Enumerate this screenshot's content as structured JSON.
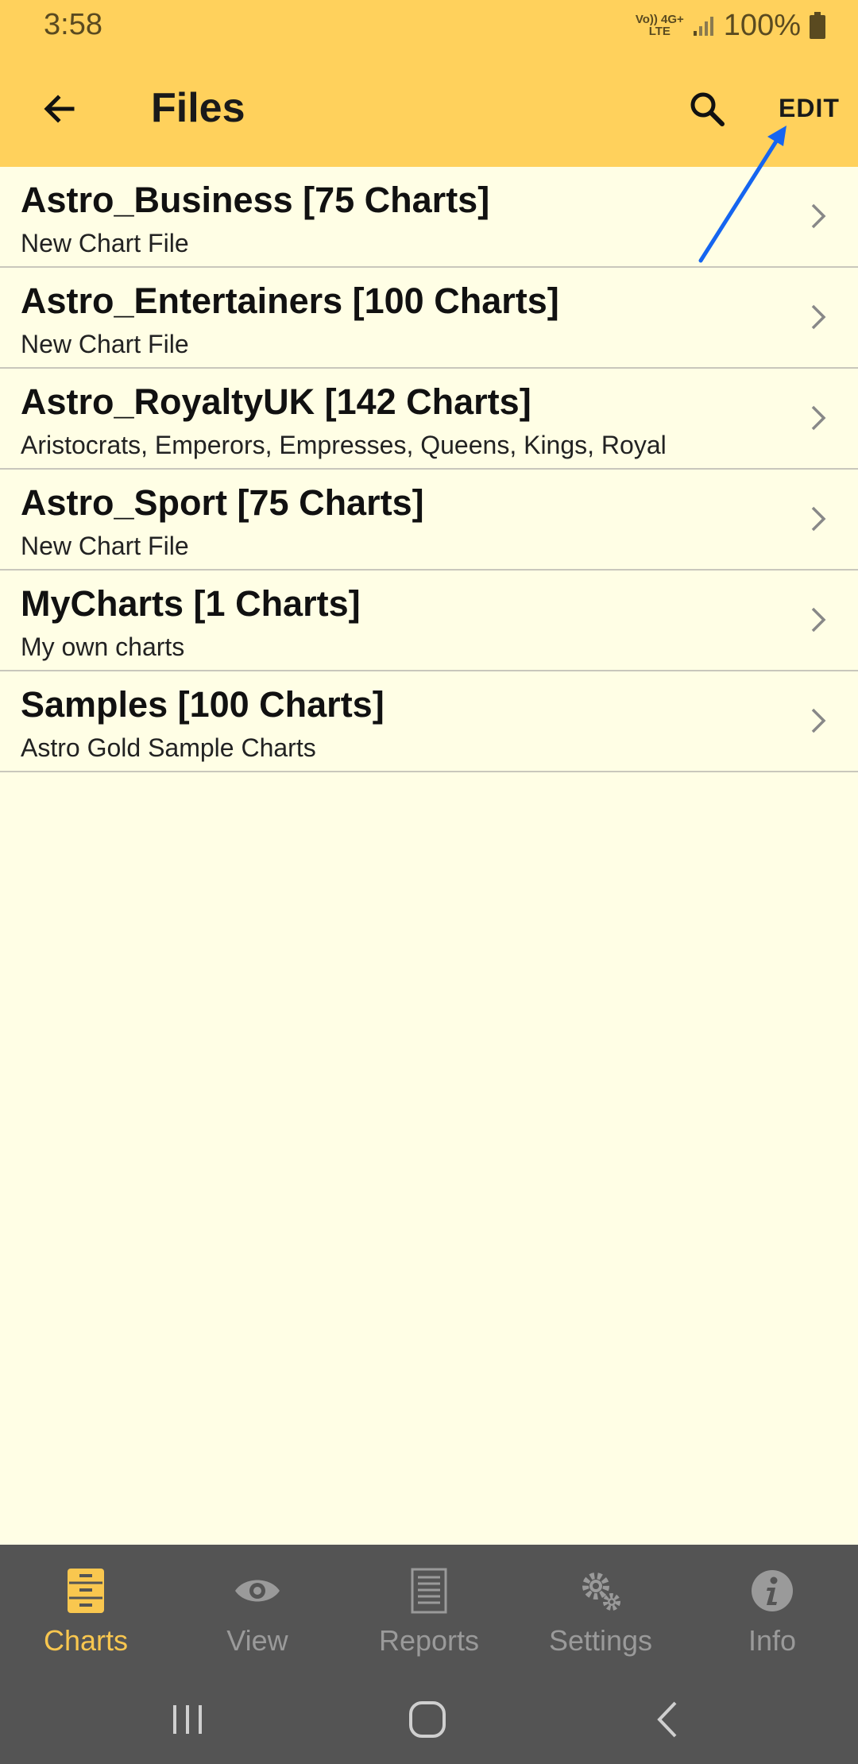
{
  "status": {
    "time": "3:58",
    "net_top": "Vo)) 4G+",
    "net_bottom": "LTE",
    "battery": "100%"
  },
  "appbar": {
    "title": "Files",
    "edit_label": "EDIT"
  },
  "files": [
    {
      "title": "Astro_Business [75 Charts]",
      "subtitle": "New Chart File"
    },
    {
      "title": "Astro_Entertainers [100 Charts]",
      "subtitle": "New Chart File"
    },
    {
      "title": "Astro_RoyaltyUK [142 Charts]",
      "subtitle": "Aristocrats, Emperors, Empresses, Queens, Kings, Royal"
    },
    {
      "title": "Astro_Sport [75 Charts]",
      "subtitle": "New Chart File"
    },
    {
      "title": "MyCharts [1 Charts]",
      "subtitle": "My own charts"
    },
    {
      "title": "Samples [100 Charts]",
      "subtitle": "Astro Gold Sample Charts"
    }
  ],
  "tabs": [
    {
      "label": "Charts",
      "icon": "file-cabinet-icon",
      "active": true
    },
    {
      "label": "View",
      "icon": "eye-icon",
      "active": false
    },
    {
      "label": "Reports",
      "icon": "document-icon",
      "active": false
    },
    {
      "label": "Settings",
      "icon": "gears-icon",
      "active": false
    },
    {
      "label": "Info",
      "icon": "info-icon",
      "active": false
    }
  ],
  "colors": {
    "appbar": "#FFD15C",
    "background": "#FFFEE5",
    "nav": "#545454",
    "active": "#F9C74F",
    "annotation": "#1565F0"
  }
}
